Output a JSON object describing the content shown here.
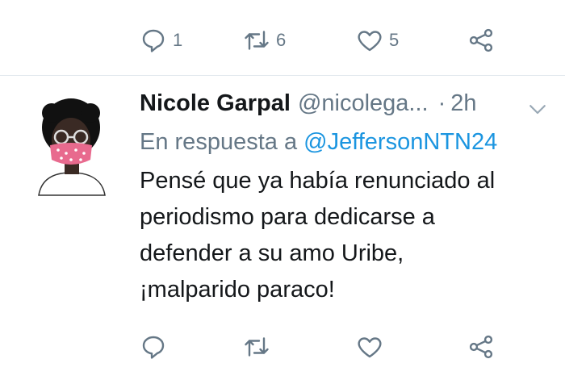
{
  "top_actions": {
    "reply_count": "1",
    "retweet_count": "6",
    "like_count": "5"
  },
  "tweet": {
    "display_name": "Nicole Garpal",
    "handle": "@nicolega...",
    "time_separator": "·",
    "time": "2h",
    "reply_prefix": "En respuesta a",
    "reply_to": "@JeffersonNTN24",
    "text_lines": [
      "Pensé que ya había renunciado al",
      "periodismo para dedicarse a",
      "defender a su amo Uribe,",
      "¡malparido paraco!"
    ]
  },
  "icons": {
    "reply": "reply-icon",
    "retweet": "retweet-icon",
    "like": "heart-icon",
    "share": "share-icon",
    "menu": "chevron-down-icon"
  },
  "colors": {
    "secondary_text": "#657786",
    "link": "#1b95e0",
    "primary_text": "#14171a",
    "divider": "#e1e8ed"
  }
}
